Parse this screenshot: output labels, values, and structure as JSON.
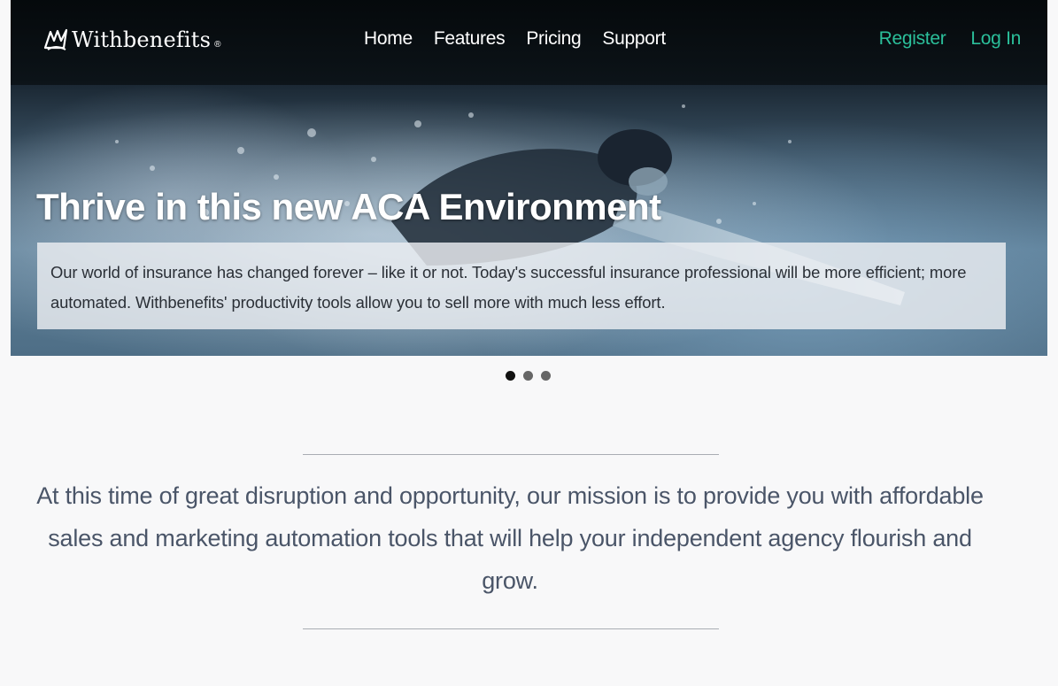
{
  "brand": {
    "name": "Withbenefits",
    "registered_mark": "®",
    "logo_icon": "stylized-w-mark-icon"
  },
  "nav": {
    "links": [
      "Home",
      "Features",
      "Pricing",
      "Support"
    ],
    "register_label": "Register",
    "login_label": "Log In"
  },
  "hero": {
    "title": "Thrive in this new ACA Environment",
    "body": "Our world of insurance has changed forever – like it or not. Today's successful insurance professional will be more efficient; more automated. Withbenefits' productivity tools allow you to sell more with much less effort.",
    "image": "underwater-swimmer-photo"
  },
  "carousel": {
    "slide_count": 3,
    "active_index": 0
  },
  "mission": {
    "text": "At this time of great disruption and opportunity, our mission is to provide you with affordable sales and marketing automation tools that will help your independent agency flourish and grow."
  },
  "colors": {
    "accent": "#2bbf9a",
    "nav_text": "#ffffff",
    "mission_text": "#4a5568",
    "page_background": "#f8f8f9"
  }
}
